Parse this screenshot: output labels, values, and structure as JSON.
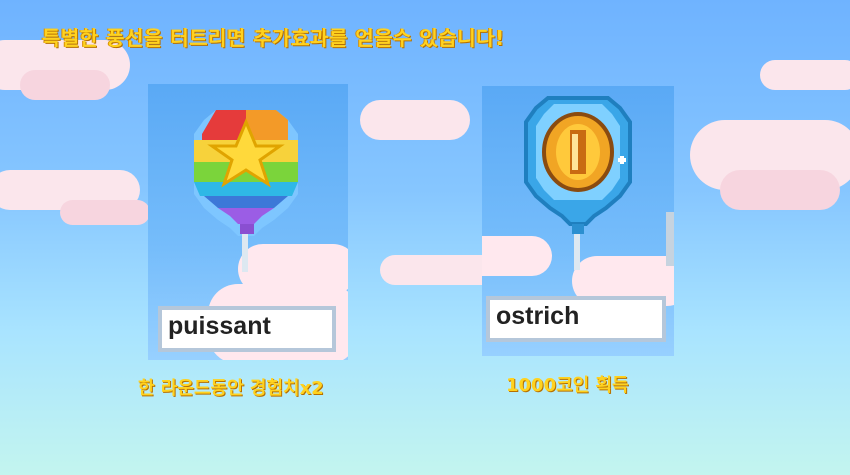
{
  "header": {
    "title": "특별한 풍선을 터트리면 추가효과를 얻을수 있습니다!"
  },
  "balloons": [
    {
      "name": "puissant",
      "effect": "한 라운드동안 경험치x2",
      "icon": "rainbow-star-balloon-icon"
    },
    {
      "name": "ostrich",
      "effect": "1000코인 획득",
      "icon": "coin-balloon-icon"
    }
  ],
  "colors": {
    "title": "#ffd21f",
    "sky": "#6fb3ff",
    "cloud": "#fbe6ec"
  }
}
